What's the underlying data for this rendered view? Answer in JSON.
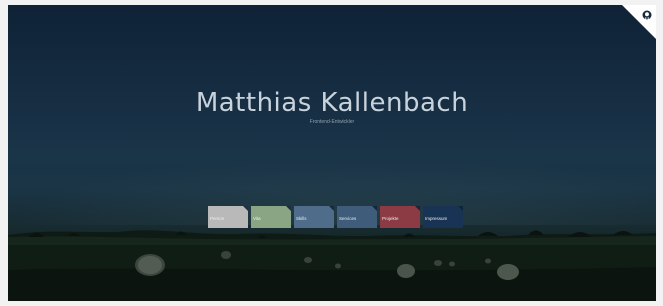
{
  "header": {
    "name": "Matthias Kallenbach",
    "subtitle": "Frontend-Entwickler"
  },
  "nav": [
    {
      "label": "Person",
      "color": "#b9b9b9"
    },
    {
      "label": "Vita",
      "color": "#8aa583"
    },
    {
      "label": "Skills",
      "color": "#4f6c8a"
    },
    {
      "label": "Services",
      "color": "#3f5c7b"
    },
    {
      "label": "Projekte",
      "color": "#8c3a43"
    },
    {
      "label": "Impressum",
      "color": "#183353"
    }
  ],
  "corner": {
    "icon": "github-icon",
    "color": "#ffffff"
  }
}
